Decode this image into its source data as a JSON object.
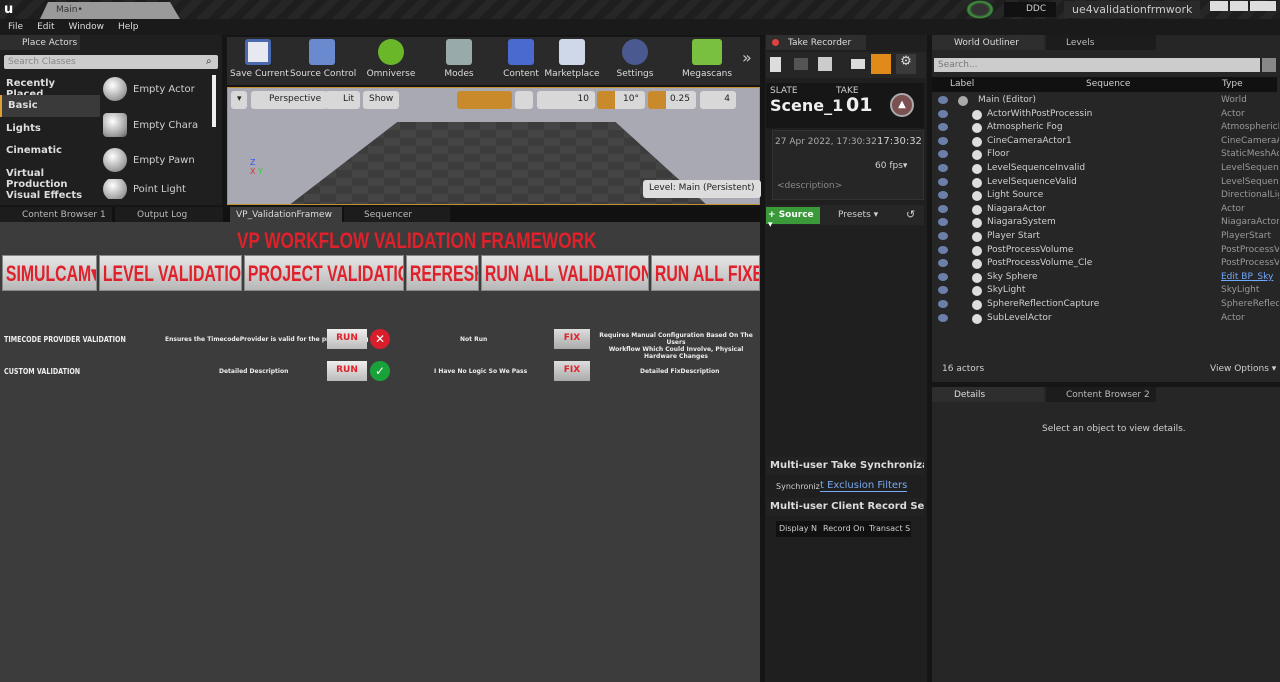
{
  "titlebar": {
    "doc_tab": "Main•",
    "ddc": "DDC",
    "project": "ue4validationfrmwork"
  },
  "menu": [
    "File",
    "Edit",
    "Window",
    "Help"
  ],
  "place_actors": {
    "tab": "Place Actors",
    "search_placeholder": "Search Classes",
    "categories": [
      "Recently Placed",
      "Basic",
      "Lights",
      "Cinematic",
      "Virtual Production",
      "Visual Effects"
    ],
    "selected_category": "Basic",
    "items": [
      "Empty Actor",
      "Empty Chara",
      "Empty Pawn",
      "Point Light"
    ]
  },
  "toolbar": [
    "Save Current",
    "Source Control",
    "Omniverse",
    "Modes",
    "Content",
    "Marketplace",
    "Settings",
    "Megascans"
  ],
  "viewport": {
    "perspective": "Perspective",
    "lit": "Lit",
    "show": "Show",
    "grid": "10",
    "rotation": "10°",
    "scale": "0.25",
    "camera_speed": "4",
    "level": "Level:  Main (Persistent)"
  },
  "bottom_tabs": [
    "Content Browser 1",
    "Output Log",
    "VP_ValidationFramew",
    "Sequencer"
  ],
  "validation": {
    "title": "VP WORKFLOW VALIDATION FRAMEWORK",
    "buttons": [
      "SIMULCAM▾",
      "LEVEL VALIDATION",
      "PROJECT VALIDATION",
      "REFRESH",
      "RUN ALL VALIDATIONS",
      "RUN ALL FIXES"
    ],
    "rows": [
      {
        "name": "TIMECODE PROVIDER VALIDATION",
        "description": "Ensures the TimecodeProvider is valid for the project config",
        "run": "RUN",
        "status": "fail",
        "result": "Not Run",
        "fix": "FIX",
        "fix_description": "Requires Manual Configuration Based On The Users\nWorkflow Which Could Involve, Physical Hardware Changes"
      },
      {
        "name": "CUSTOM VALIDATION",
        "description": "Detailed Description",
        "run": "RUN",
        "status": "pass",
        "result": "I Have No Logic So We Pass",
        "fix": "FIX",
        "fix_description": "Detailed FixDescription"
      }
    ],
    "colors": {
      "title": "#e0202a",
      "fail": "#d81e2a",
      "pass": "#1aa23a"
    }
  },
  "take_recorder": {
    "tab": "Take Recorder",
    "slate_label": "SLATE",
    "slate": "Scene_1",
    "take_label": "TAKE",
    "take": "01",
    "date": "27 Apr 2022, 17:30:32",
    "timecode": "17:30:32:5",
    "fps": "60 fps▾",
    "description": "<description>",
    "source": "Source ▾",
    "presets": "Presets ▾",
    "sync_section": "Multi-user Take Synchronization",
    "sync_label": "Synchroniz",
    "exclusion": "t Exclusion Filters",
    "client_section": "Multi-user Client Record Settings",
    "columns": [
      "Display N",
      "Record On",
      "Transact S"
    ]
  },
  "outliner": {
    "tabs": [
      "World Outliner",
      "Levels"
    ],
    "search_placeholder": "Search...",
    "columns": [
      "Label",
      "Sequence",
      "Type"
    ],
    "rows": [
      {
        "label": "Main (Editor)",
        "type": "World"
      },
      {
        "label": "ActorWithPostProcessin",
        "type": "Actor"
      },
      {
        "label": "Atmospheric Fog",
        "type": "AtmosphericF"
      },
      {
        "label": "CineCameraActor1",
        "type": "CineCameraA"
      },
      {
        "label": "Floor",
        "type": "StaticMeshAc"
      },
      {
        "label": "LevelSequenceInvalid",
        "type": "LevelSequenc"
      },
      {
        "label": "LevelSequenceValid",
        "type": "LevelSequenc"
      },
      {
        "label": "Light Source",
        "type": "DirectionalLig"
      },
      {
        "label": "NiagaraActor",
        "type": "Actor"
      },
      {
        "label": "NiagaraSystem",
        "type": "NiagaraActor"
      },
      {
        "label": "Player Start",
        "type": "PlayerStart"
      },
      {
        "label": "PostProcessVolume",
        "type": "PostProcessV"
      },
      {
        "label": "PostProcessVolume_Cle",
        "type": "PostProcessV"
      },
      {
        "label": "Sky Sphere",
        "type": "Edit BP_Sky"
      },
      {
        "label": "SkyLight",
        "type": "SkyLight"
      },
      {
        "label": "SphereReflectionCapture",
        "type": "SphereReflect"
      },
      {
        "label": "SubLevelActor",
        "type": "Actor"
      }
    ],
    "count": "16 actors",
    "view_options": "View Options ▾"
  },
  "details": {
    "tabs": [
      "Details",
      "Content Browser 2"
    ],
    "empty": "Select an object to view details."
  }
}
